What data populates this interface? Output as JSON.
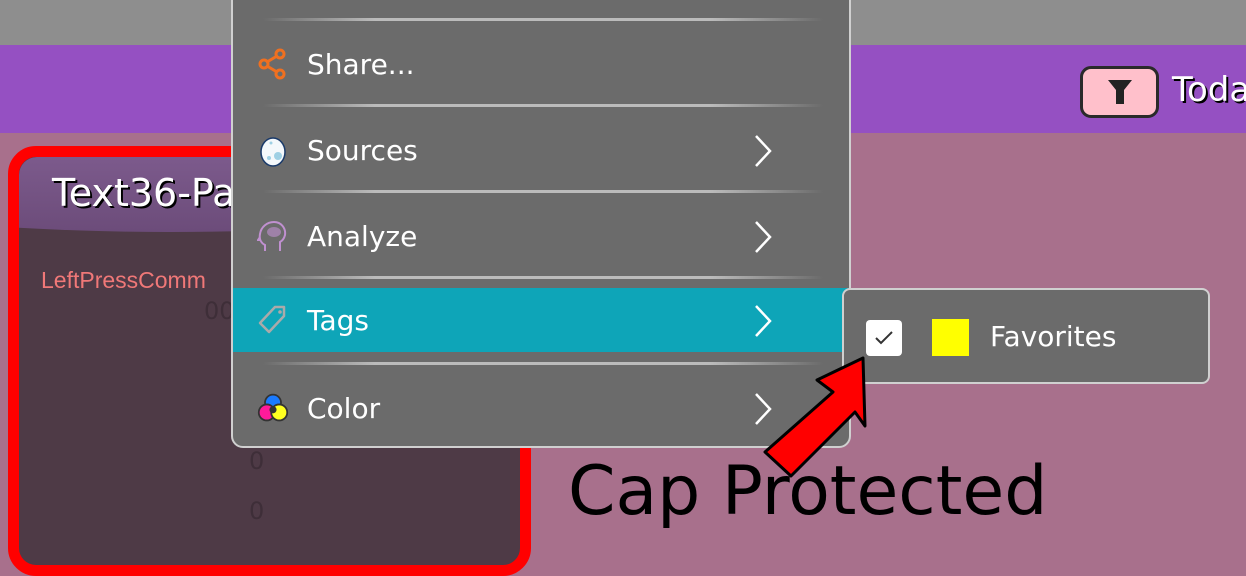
{
  "header": {
    "filter_icon": "filter-icon",
    "today_label": "Toda"
  },
  "panel": {
    "title": "Text36-Pa",
    "command_label": "LeftPressComm",
    "value_1": "000",
    "value_2": "0",
    "value_3": "0",
    "border_color": "#ff0000"
  },
  "context_menu": {
    "items": [
      {
        "label": "Share...",
        "icon": "share-icon",
        "has_submenu": false
      },
      {
        "label": "Sources",
        "icon": "egg-icon",
        "has_submenu": true
      },
      {
        "label": "Analyze",
        "icon": "brain-head-icon",
        "has_submenu": true
      },
      {
        "label": "Tags",
        "icon": "tag-icon",
        "has_submenu": true,
        "highlighted": true
      },
      {
        "label": "Color",
        "icon": "color-circles-icon",
        "has_submenu": true
      }
    ],
    "highlight_color": "#0ea5b8"
  },
  "tags_submenu": {
    "items": [
      {
        "label": "Favorites",
        "checked": true,
        "color": "#ffff00"
      }
    ]
  },
  "annotation": {
    "text": "Cap Protected",
    "arrow_color": "#ff0000"
  }
}
